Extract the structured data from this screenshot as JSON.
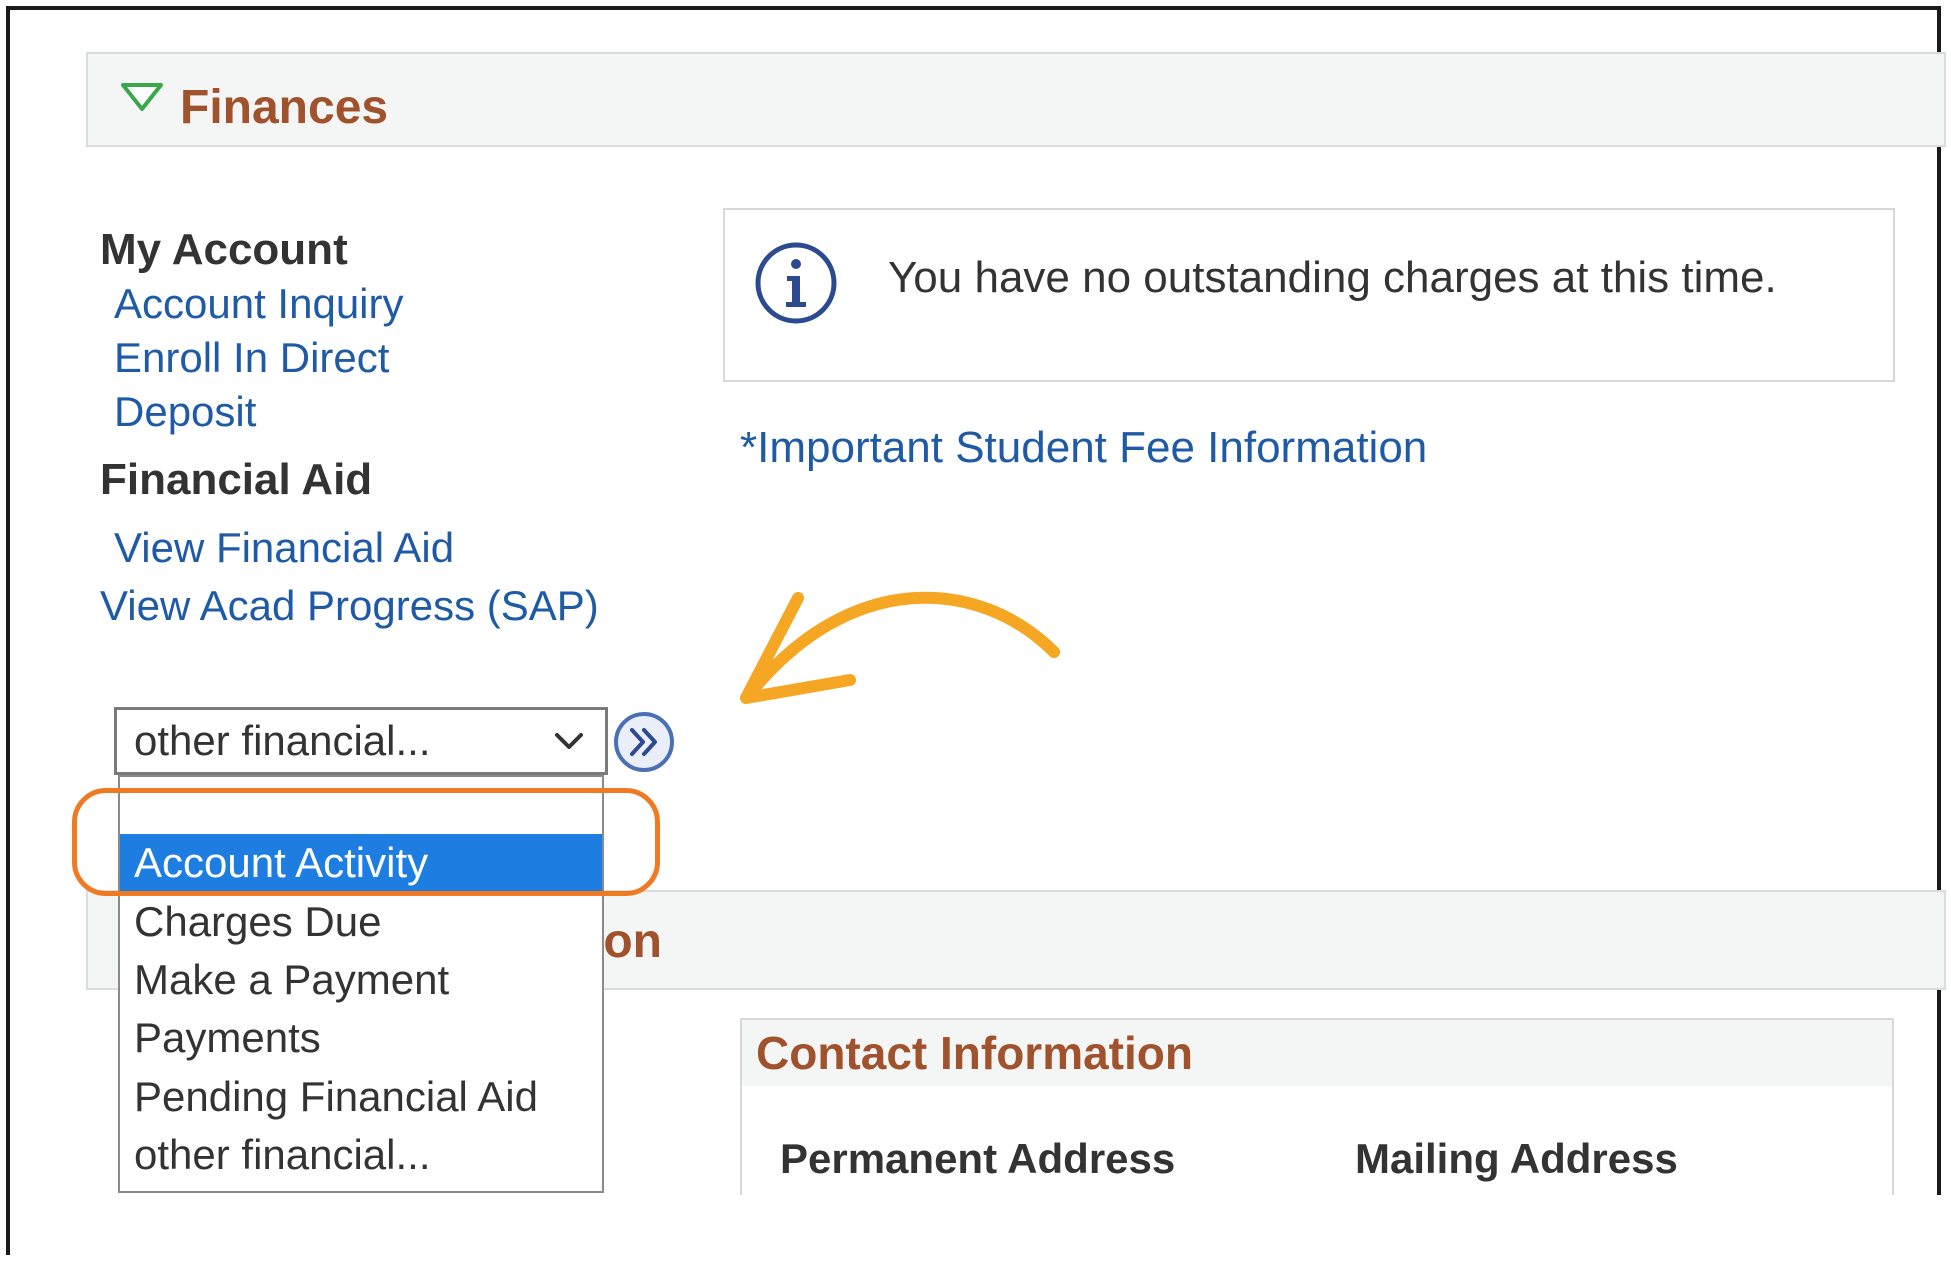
{
  "finances": {
    "title": "Finances"
  },
  "nav": {
    "my_account_heading": "My Account",
    "account_inquiry": "Account Inquiry",
    "enroll_direct_deposit_line1": "Enroll In Direct",
    "enroll_direct_deposit_line2": "Deposit",
    "financial_aid_heading": "Financial Aid",
    "view_financial_aid": "View Financial Aid",
    "view_acad_progress": "View Acad Progress (SAP)"
  },
  "info": {
    "message": "You have no outstanding charges at this time.",
    "fee_link": "*Important Student Fee Information"
  },
  "select": {
    "value": "other financial...",
    "options": [
      "",
      "Account Activity",
      "Charges Due",
      "Make a Payment",
      "Payments",
      "Pending Financial Aid",
      "other financial..."
    ],
    "selected_option": "Account Activity"
  },
  "section2": {
    "title_visible_fragment": "tion"
  },
  "contact": {
    "title": "Contact Information",
    "permanent_address": "Permanent Address",
    "mailing_address": "Mailing Address"
  },
  "colors": {
    "link": "#1f5aa6",
    "section_title": "#a0522d",
    "selected_option_bg": "#1e7de0",
    "annotation_orange": "#f5a623",
    "highlight_ring": "#f07a22"
  }
}
